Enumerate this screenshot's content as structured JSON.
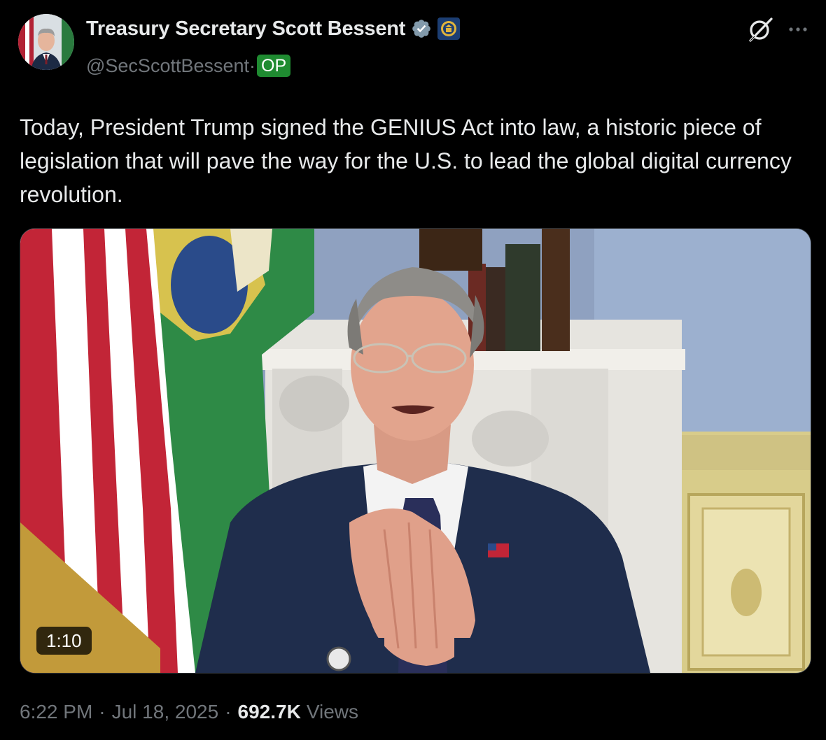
{
  "author": {
    "display_name": "Treasury Secretary Scott Bessent",
    "handle": "@SecScottBessent",
    "handle_separator": "·",
    "op_label": "OP"
  },
  "icons": {
    "avatar": "profile-photo",
    "verified": "verified-badge-icon",
    "affiliation": "treasury-seal-icon",
    "grok": "grok-icon",
    "more": "more-options-icon"
  },
  "tweet": {
    "text": "Today, President Trump signed the GENIUS Act into law, a historic piece of legislation that will pave the way for the U.S. to lead the global digital currency revolution."
  },
  "media": {
    "type": "video",
    "duration": "1:10"
  },
  "meta": {
    "time": "6:22 PM",
    "separator": "·",
    "date": "Jul 18, 2025",
    "views_count": "692.7K",
    "views_label": "Views"
  },
  "colors": {
    "background": "#000000",
    "text_primary": "#e7e9ea",
    "text_secondary": "#71767b",
    "verified_badge": "#829aab",
    "op_badge": "#1f8b31"
  }
}
